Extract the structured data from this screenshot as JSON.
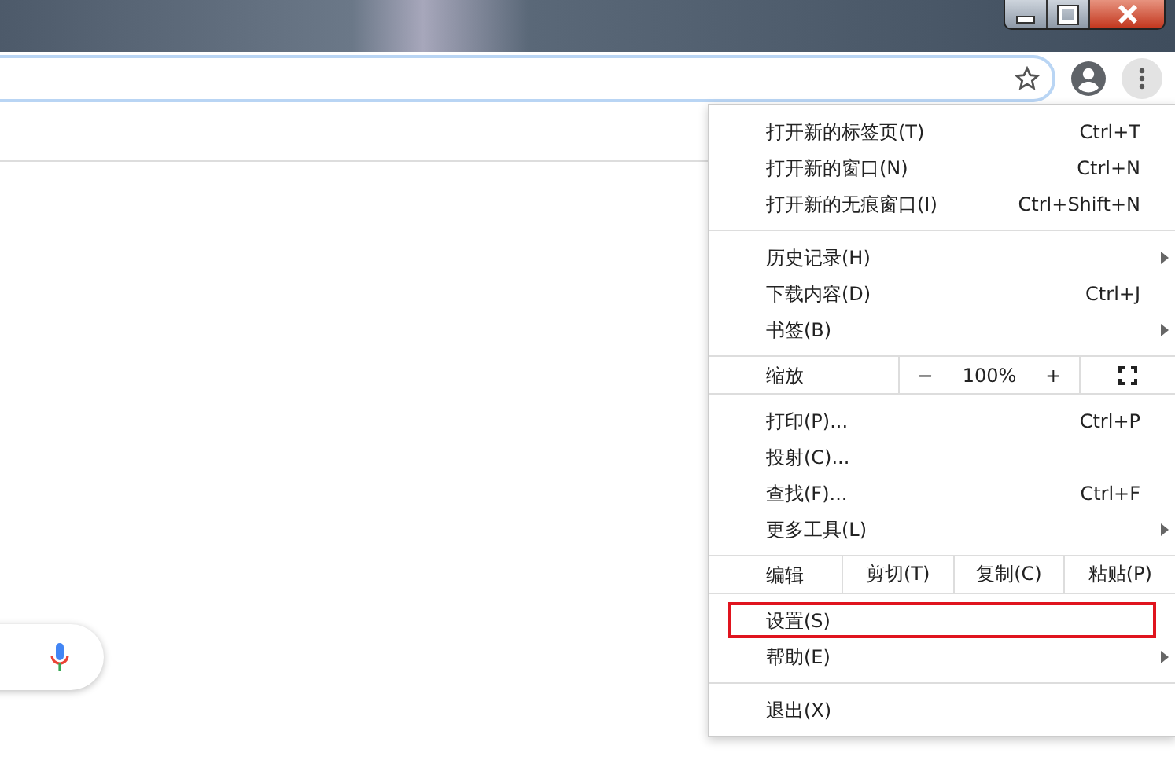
{
  "toolbar": {
    "menu_expanded": true
  },
  "menu": {
    "groups": [
      {
        "items": [
          {
            "kind": "item",
            "label": "打开新的标签页(T)",
            "shortcut": "Ctrl+T",
            "submenu": false,
            "selected": false
          },
          {
            "kind": "item",
            "label": "打开新的窗口(N)",
            "shortcut": "Ctrl+N",
            "submenu": false,
            "selected": false
          },
          {
            "kind": "item",
            "label": "打开新的无痕窗口(I)",
            "shortcut": "Ctrl+Shift+N",
            "submenu": false,
            "selected": false
          }
        ]
      },
      {
        "items": [
          {
            "kind": "item",
            "label": "历史记录(H)",
            "submenu": true,
            "selected": false
          },
          {
            "kind": "item",
            "label": "下载内容(D)",
            "shortcut": "Ctrl+J",
            "submenu": false,
            "selected": false
          },
          {
            "kind": "item",
            "label": "书签(B)",
            "submenu": true,
            "selected": false
          }
        ]
      },
      {
        "items": [
          {
            "kind": "zoom",
            "label": "缩放",
            "minus": "−",
            "value": "100%",
            "plus": "+"
          }
        ]
      },
      {
        "items": [
          {
            "kind": "item",
            "label": "打印(P)...",
            "shortcut": "Ctrl+P",
            "submenu": false,
            "selected": false
          },
          {
            "kind": "item",
            "label": "投射(C)...",
            "submenu": false,
            "selected": false
          },
          {
            "kind": "item",
            "label": "查找(F)...",
            "shortcut": "Ctrl+F",
            "submenu": false,
            "selected": false
          },
          {
            "kind": "item",
            "label": "更多工具(L)",
            "submenu": true,
            "selected": false
          }
        ]
      },
      {
        "items": [
          {
            "kind": "edit",
            "label": "编辑",
            "actions": [
              "剪切(T)",
              "复制(C)",
              "粘贴(P)"
            ]
          }
        ]
      },
      {
        "items": [
          {
            "kind": "item",
            "label": "设置(S)",
            "submenu": false,
            "selected": true
          },
          {
            "kind": "item",
            "label": "帮助(E)",
            "submenu": true,
            "selected": false
          }
        ]
      },
      {
        "items": [
          {
            "kind": "item",
            "label": "退出(X)",
            "submenu": false,
            "selected": false
          }
        ]
      }
    ]
  }
}
